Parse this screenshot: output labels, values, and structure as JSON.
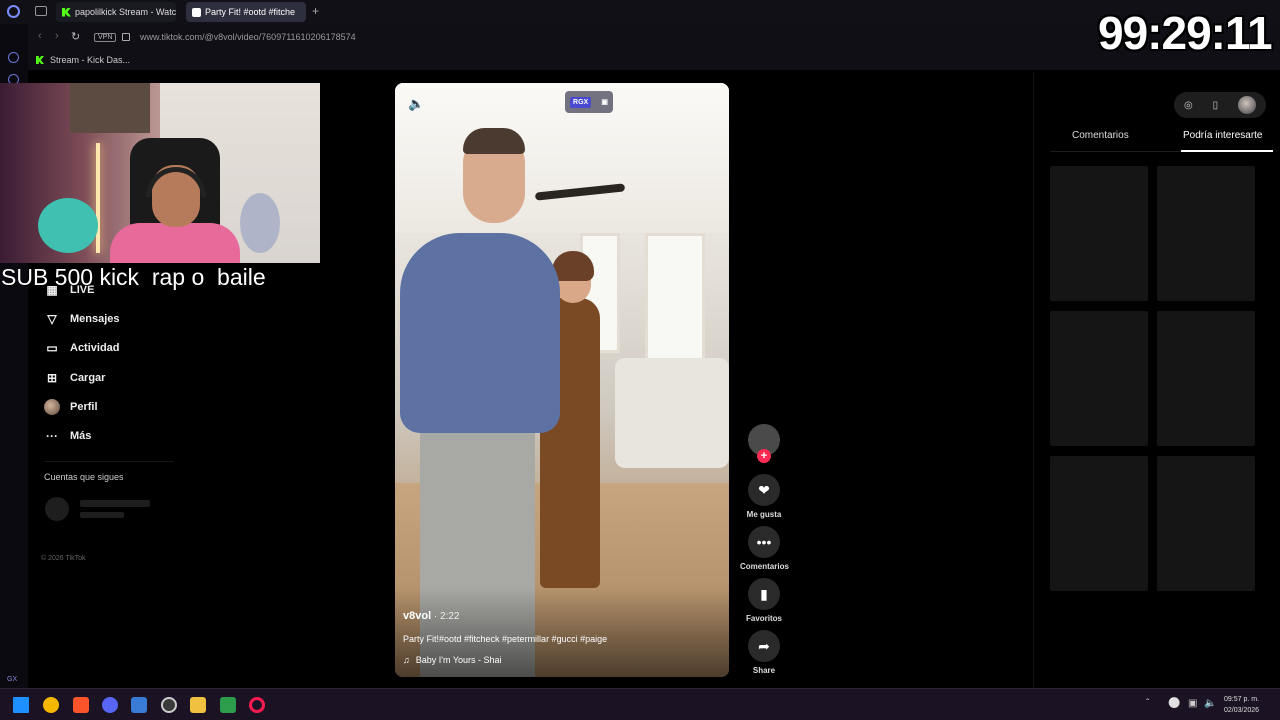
{
  "browser": {
    "tabs": [
      {
        "label": "papolilkick Stream - Watc",
        "favicon": "kick-icon"
      },
      {
        "label": "Party Fit! #ootd #fitche",
        "favicon": "tiktok-icon"
      }
    ],
    "url": "www.tiktok.com/@v8vol/video/7609711610206178574",
    "vpn_label": "VPN",
    "bookmark": "Stream - Kick Das..."
  },
  "timer": "99:29:11",
  "stream_overlay_text": "SUB 500 kick  rap o  baile",
  "sidebar": {
    "items": [
      {
        "label": "LIVE",
        "icon": "live-icon"
      },
      {
        "label": "Mensajes",
        "icon": "messages-icon"
      },
      {
        "label": "Actividad",
        "icon": "activity-icon"
      },
      {
        "label": "Cargar",
        "icon": "upload-icon"
      },
      {
        "label": "Perfil",
        "icon": "profile-avatar"
      },
      {
        "label": "Más",
        "icon": "more-icon"
      }
    ],
    "following_title": "Cuentas que sigues",
    "copyright": "© 2026 TikTok"
  },
  "video": {
    "author": "v8vol",
    "duration": " · 2:22",
    "caption": "Party Fit!#ootd #fitcheck #petermillar #gucci #paige",
    "music": "Baby I'm Yours - Shai",
    "rgx_label": "RGX"
  },
  "actions": {
    "like": "Me gusta",
    "comments": "Comentarios",
    "favorites": "Favoritos",
    "share": "Share"
  },
  "right_panel": {
    "tab_comments": "Comentarios",
    "tab_recommended": "Podría interesarte"
  },
  "taskbar": {
    "time": "09:57 p. m.",
    "date": "02/03/2026"
  },
  "colors": {
    "accent": "#fe2c55",
    "background": "#000000",
    "taskbar": "#1b1324"
  }
}
